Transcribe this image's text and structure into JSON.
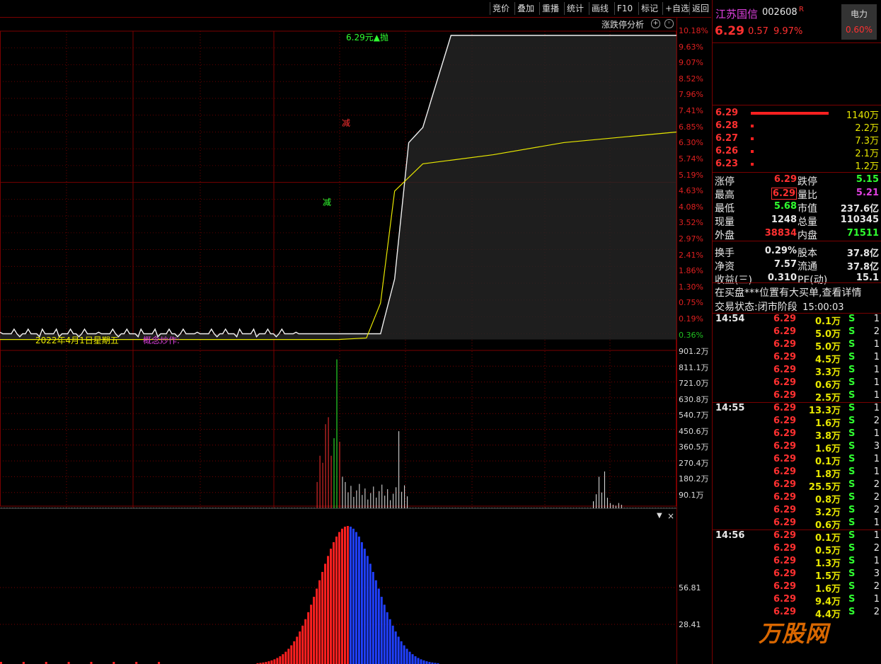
{
  "toolbar": {
    "buttons": [
      "竞价",
      "叠加",
      "重播",
      "统计",
      "画线",
      "F10",
      "标记",
      "+自选",
      "返回"
    ]
  },
  "chart": {
    "analysis_label": "涨跌停分析",
    "price_label": "6.29元",
    "limit_up_marker": "▲抛",
    "marker_1": "减",
    "marker_2": "减",
    "date_label": "2022年4月1日星期五",
    "concept_label": "概念炒作:",
    "price_axis": [
      "10.18%",
      "9.63%",
      "9.07%",
      "8.52%",
      "7.96%",
      "7.41%",
      "6.85%",
      "6.30%",
      "5.74%",
      "5.19%",
      "4.63%",
      "4.08%",
      "3.52%",
      "2.97%",
      "2.41%",
      "1.86%",
      "1.30%",
      "0.75%",
      "0.19%",
      "0.36%"
    ],
    "volume_axis": [
      "901.2万",
      "811.1万",
      "721.0万",
      "630.8万",
      "540.7万",
      "450.6万",
      "360.5万",
      "270.4万",
      "180.2万",
      "90.1万"
    ],
    "bottom_axis": [
      "56.81",
      "28.41"
    ]
  },
  "chart_data": [
    {
      "type": "line",
      "series": [
        {
          "x": [
            0,
            60,
            100,
            120,
            130,
            135,
            140,
            145,
            150,
            160,
            175,
            200,
            240
          ],
          "values": [
            0.19,
            0.19,
            0.19,
            0.19,
            0.19,
            0.19,
            2.0,
            6.5,
            7.0,
            10.04,
            10.04,
            10.04,
            10.04
          ]
        },
        {
          "x": [
            0,
            60,
            100,
            120,
            130,
            135,
            140,
            150,
            175,
            200,
            240
          ],
          "values": [
            0.0,
            0.0,
            0.0,
            0.0,
            0.05,
            1.2,
            4.9,
            5.8,
            6.1,
            6.5,
            6.85
          ]
        }
      ],
      "ylim": [
        -0.36,
        10.18
      ]
    }
  ],
  "stock": {
    "name": "江苏国信",
    "code": "002608",
    "flag": "R",
    "sector": "电力",
    "sector_pct": "0.60%",
    "price": "6.29",
    "change": "0.57",
    "change_pct": "9.97%"
  },
  "orderbook": [
    {
      "price": "6.29",
      "vol": "1140万"
    },
    {
      "price": "6.28",
      "vol": "2.2万"
    },
    {
      "price": "6.27",
      "vol": "7.3万"
    },
    {
      "price": "6.26",
      "vol": "2.1万"
    },
    {
      "price": "6.23",
      "vol": "1.2万"
    }
  ],
  "stats": [
    {
      "l1": "涨停",
      "v1": "6.29",
      "l2": "跌停",
      "v2": "5.15"
    },
    {
      "l1": "最高",
      "v1": "6.29",
      "l2": "量比",
      "v2": "5.21"
    },
    {
      "l1": "最低",
      "v1": "5.68",
      "l2": "市值",
      "v2": "237.6亿"
    },
    {
      "l1": "现量",
      "v1": "1248",
      "l2": "总量",
      "v2": "110345"
    },
    {
      "l1": "外盘",
      "v1": "38834",
      "l2": "内盘",
      "v2": "71511"
    },
    {
      "l1": "换手",
      "v1": "0.29%",
      "l2": "股本",
      "v2": "37.8亿"
    },
    {
      "l1": "净资",
      "v1": "7.57",
      "l2": "流通",
      "v2": "37.8亿"
    },
    {
      "l1": "收益(三)",
      "v1": "0.310",
      "l2": "PE(动)",
      "v2": "15.1"
    }
  ],
  "notice": "在买盘***位置有大买单,查看详情",
  "trade_status": {
    "label": "交易状态:",
    "value": "闭市阶段",
    "time": "15:00:03"
  },
  "ticks": [
    {
      "time": "14:54",
      "price": "6.29",
      "vol": "0.1万",
      "bs": "S",
      "n": "1"
    },
    {
      "time": "",
      "price": "6.29",
      "vol": "5.0万",
      "bs": "S",
      "n": "2"
    },
    {
      "time": "",
      "price": "6.29",
      "vol": "5.0万",
      "bs": "S",
      "n": "1"
    },
    {
      "time": "",
      "price": "6.29",
      "vol": "4.5万",
      "bs": "S",
      "n": "1"
    },
    {
      "time": "",
      "price": "6.29",
      "vol": "3.3万",
      "bs": "S",
      "n": "1"
    },
    {
      "time": "",
      "price": "6.29",
      "vol": "0.6万",
      "bs": "S",
      "n": "1"
    },
    {
      "time": "",
      "price": "6.29",
      "vol": "2.5万",
      "bs": "S",
      "n": "1"
    },
    {
      "time": "14:55",
      "price": "6.29",
      "vol": "13.3万",
      "bs": "S",
      "n": "1"
    },
    {
      "time": "",
      "price": "6.29",
      "vol": "1.6万",
      "bs": "S",
      "n": "2"
    },
    {
      "time": "",
      "price": "6.29",
      "vol": "3.8万",
      "bs": "S",
      "n": "1"
    },
    {
      "time": "",
      "price": "6.29",
      "vol": "1.6万",
      "bs": "S",
      "n": "3"
    },
    {
      "time": "",
      "price": "6.29",
      "vol": "0.1万",
      "bs": "S",
      "n": "1"
    },
    {
      "time": "",
      "price": "6.29",
      "vol": "1.8万",
      "bs": "S",
      "n": "1"
    },
    {
      "time": "",
      "price": "6.29",
      "vol": "25.5万",
      "bs": "S",
      "n": "2"
    },
    {
      "time": "",
      "price": "6.29",
      "vol": "0.8万",
      "bs": "S",
      "n": "2"
    },
    {
      "time": "",
      "price": "6.29",
      "vol": "3.2万",
      "bs": "S",
      "n": "2"
    },
    {
      "time": "",
      "price": "6.29",
      "vol": "0.6万",
      "bs": "S",
      "n": "1"
    },
    {
      "time": "14:56",
      "price": "6.29",
      "vol": "0.1万",
      "bs": "S",
      "n": "1"
    },
    {
      "time": "",
      "price": "6.29",
      "vol": "0.5万",
      "bs": "S",
      "n": "2"
    },
    {
      "time": "",
      "price": "6.29",
      "vol": "1.3万",
      "bs": "S",
      "n": "1"
    },
    {
      "time": "",
      "price": "6.29",
      "vol": "1.5万",
      "bs": "S",
      "n": "3"
    },
    {
      "time": "",
      "price": "6.29",
      "vol": "1.6万",
      "bs": "S",
      "n": "2"
    },
    {
      "time": "",
      "price": "6.29",
      "vol": "9.4万",
      "bs": "S",
      "n": "1"
    },
    {
      "time": "",
      "price": "6.29",
      "vol": "4.4万",
      "bs": "S",
      "n": "2"
    }
  ],
  "watermark": "万股网",
  "colors": {
    "up": "#ff3030",
    "down": "#30ff30",
    "grid": "#7a0000",
    "avg": "#e8e800"
  }
}
